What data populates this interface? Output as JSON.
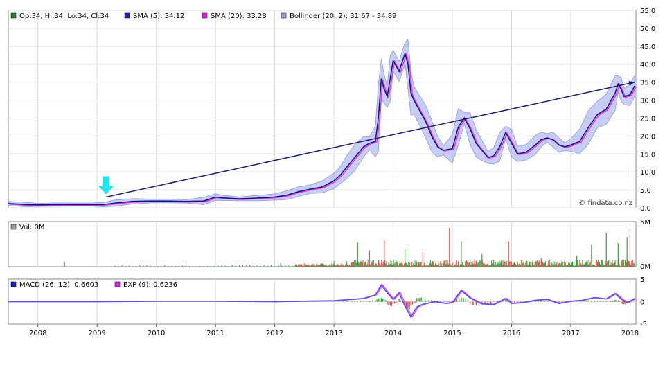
{
  "chart_data": [
    {
      "type": "line",
      "legend": [
        {
          "label": "Op:34, Hi:34, Lo:34, Cl:34",
          "color": "#2e7d32"
        },
        {
          "label": "SMA (5): 34.12",
          "color": "#1a24c8"
        },
        {
          "label": "SMA (20): 33.28",
          "color": "#e020e0"
        },
        {
          "label": "Bollinger (20, 2): 31.67 - 34.89",
          "color": "#9aa4ec"
        }
      ],
      "x_ticks": [
        "2008",
        "2009",
        "2010",
        "2011",
        "2012",
        "2013",
        "2014",
        "2015",
        "2016",
        "2017",
        "2018"
      ],
      "y_ticks": [
        "0.0",
        "5.0",
        "10.0",
        "15.0",
        "20.0",
        "25.0",
        "30.0",
        "35.0",
        "40.0",
        "45.0",
        "50.0",
        "55.0"
      ],
      "ylim": [
        0,
        55
      ],
      "xlim": [
        2007.5,
        2018.1
      ],
      "grid": true,
      "watermark": "© findata.co.nz",
      "series": [
        {
          "x": [
            2007.5,
            2007.8,
            2008.0,
            2008.3,
            2008.6,
            2008.9,
            2009.1,
            2009.3,
            2009.6,
            2009.9,
            2010.2,
            2010.5,
            2010.8,
            2011.0,
            2011.1,
            2011.4,
            2011.7,
            2012.0,
            2012.2,
            2012.4,
            2012.6,
            2012.8,
            2013.0,
            2013.1,
            2013.2,
            2013.35,
            2013.5,
            2013.6,
            2013.7,
            2013.75,
            2013.8,
            2013.85,
            2013.9,
            2013.95,
            2014.0,
            2014.1,
            2014.2,
            2014.25,
            2014.3,
            2014.35,
            2014.45,
            2014.55,
            2014.65,
            2014.75,
            2014.85,
            2015.0,
            2015.1,
            2015.2,
            2015.3,
            2015.4,
            2015.5,
            2015.6,
            2015.7,
            2015.8,
            2015.9,
            2016.0,
            2016.1,
            2016.25,
            2016.4,
            2016.5,
            2016.6,
            2016.7,
            2016.8,
            2016.9,
            2017.0,
            2017.15,
            2017.3,
            2017.45,
            2017.6,
            2017.75,
            2017.8,
            2017.85,
            2017.9,
            2018.0,
            2018.08
          ],
          "y": [
            1.2,
            0.9,
            0.8,
            0.9,
            0.9,
            0.9,
            0.9,
            1.3,
            1.8,
            1.9,
            1.9,
            1.8,
            1.9,
            3.0,
            2.8,
            2.5,
            2.7,
            3.0,
            3.5,
            4.5,
            5.2,
            5.8,
            7.5,
            9.0,
            11.0,
            14.0,
            17.0,
            18.0,
            18.5,
            25.0,
            36.0,
            33.0,
            31.0,
            36.0,
            41.0,
            38.0,
            43.0,
            40.0,
            32.0,
            30.0,
            27.0,
            24.0,
            20.0,
            17.0,
            16.0,
            16.5,
            22.5,
            25.0,
            22.0,
            18.0,
            16.0,
            14.0,
            14.5,
            17.0,
            21.0,
            18.0,
            15.0,
            15.5,
            17.5,
            19.0,
            19.5,
            19.0,
            17.5,
            17.0,
            17.5,
            18.5,
            22.5,
            26.0,
            27.5,
            32.0,
            34.5,
            33.0,
            31.0,
            31.5,
            34.0
          ]
        }
      ],
      "annotations": [
        {
          "type": "trendline",
          "from": [
            2009.15,
            3.0
          ],
          "to": [
            2018.08,
            35.0
          ]
        },
        {
          "type": "arrow-marker",
          "at": [
            2009.15,
            3.0
          ]
        }
      ]
    },
    {
      "type": "bar",
      "legend": [
        {
          "label": "Vol: 0M",
          "color": "#9a9a9a"
        }
      ],
      "y_ticks": [
        "5M",
        "0M"
      ],
      "ylim": [
        0,
        5
      ],
      "spikes": [
        {
          "x": 2008.45,
          "v": 0.5,
          "c": "#d9534f"
        },
        {
          "x": 2012.1,
          "v": 0.4,
          "c": "#3a9c3a"
        },
        {
          "x": 2013.0,
          "v": 0.6,
          "c": "#3a9c3a"
        },
        {
          "x": 2013.4,
          "v": 2.7,
          "c": "#3a9c3a"
        },
        {
          "x": 2013.6,
          "v": 1.8,
          "c": "#d9534f"
        },
        {
          "x": 2013.85,
          "v": 2.9,
          "c": "#d9534f"
        },
        {
          "x": 2014.2,
          "v": 2.0,
          "c": "#3a9c3a"
        },
        {
          "x": 2014.5,
          "v": 1.6,
          "c": "#d9534f"
        },
        {
          "x": 2014.95,
          "v": 4.3,
          "c": "#d9534f"
        },
        {
          "x": 2015.15,
          "v": 2.8,
          "c": "#3a9c3a"
        },
        {
          "x": 2015.5,
          "v": 1.4,
          "c": "#3a9c3a"
        },
        {
          "x": 2015.95,
          "v": 2.8,
          "c": "#d9534f"
        },
        {
          "x": 2016.5,
          "v": 0.9,
          "c": "#3a9c3a"
        },
        {
          "x": 2017.1,
          "v": 1.2,
          "c": "#3a9c3a"
        },
        {
          "x": 2017.35,
          "v": 2.4,
          "c": "#3a9c3a"
        },
        {
          "x": 2017.6,
          "v": 3.8,
          "c": "#3a9c3a"
        },
        {
          "x": 2017.8,
          "v": 2.6,
          "c": "#3a9c3a"
        },
        {
          "x": 2017.95,
          "v": 3.3,
          "c": "#3a9c3a"
        },
        {
          "x": 2018.0,
          "v": 4.2,
          "c": "#d9534f"
        }
      ]
    },
    {
      "type": "line",
      "legend": [
        {
          "label": "MACD (26, 12): 0.6603",
          "color": "#1a24c8"
        },
        {
          "label": "EXP (9): 0.6236",
          "color": "#e020e0"
        }
      ],
      "y_ticks": [
        "5",
        "0",
        "-5"
      ],
      "ylim": [
        -5,
        5
      ],
      "series": [
        {
          "x": [
            2007.5,
            2009.0,
            2010.0,
            2011.0,
            2012.0,
            2013.0,
            2013.3,
            2013.5,
            2013.7,
            2013.8,
            2013.9,
            2014.0,
            2014.1,
            2014.2,
            2014.3,
            2014.4,
            2014.5,
            2014.7,
            2014.9,
            2015.0,
            2015.15,
            2015.3,
            2015.5,
            2015.7,
            2015.9,
            2016.0,
            2016.2,
            2016.4,
            2016.6,
            2016.8,
            2017.0,
            2017.2,
            2017.4,
            2017.6,
            2017.75,
            2017.85,
            2017.95,
            2018.08
          ],
          "y": [
            0,
            0,
            0.1,
            0.1,
            0,
            0.2,
            0.5,
            0.7,
            1.5,
            3.7,
            2.0,
            0.5,
            2.0,
            -1.0,
            -3.4,
            -1.2,
            -0.6,
            0,
            -0.4,
            -0.2,
            2.5,
            0.8,
            -0.5,
            -0.6,
            0.7,
            -0.4,
            -0.2,
            0.3,
            0.5,
            -0.4,
            0.1,
            0.3,
            0.9,
            0.6,
            1.8,
            0.6,
            -0.2,
            0.66
          ]
        }
      ]
    }
  ]
}
